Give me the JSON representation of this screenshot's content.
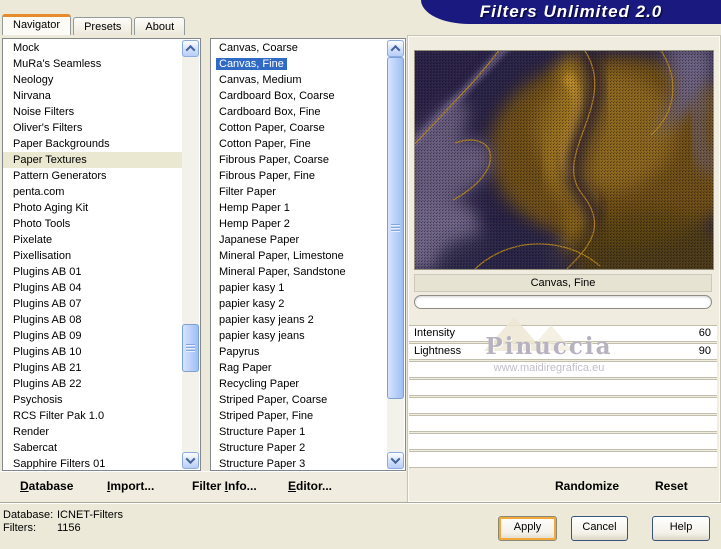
{
  "titlebar": {
    "title": "Filters Unlimited 2.0"
  },
  "tabs": {
    "navigator": "Navigator",
    "presets": "Presets",
    "about": "About"
  },
  "navigator": {
    "categories": [
      "Mock",
      "MuRa's Seamless",
      "Neology",
      "Nirvana",
      "Noise Filters",
      "Oliver's Filters",
      "Paper Backgrounds",
      "Paper Textures",
      "Pattern Generators",
      "penta.com",
      "Photo Aging Kit",
      "Photo Tools",
      "Pixelate",
      "Pixellisation",
      "Plugins AB 01",
      "Plugins AB 04",
      "Plugins AB 07",
      "Plugins AB 08",
      "Plugins AB 09",
      "Plugins AB 10",
      "Plugins AB 21",
      "Plugins AB 22",
      "Psychosis",
      "RCS Filter Pak 1.0",
      "Render",
      "Sabercat",
      "Sapphire Filters 01"
    ],
    "selected_category": "Paper Textures",
    "filters": [
      "Canvas, Coarse",
      "Canvas, Fine",
      "Canvas, Medium",
      "Cardboard Box, Coarse",
      "Cardboard Box, Fine",
      "Cotton Paper, Coarse",
      "Cotton Paper, Fine",
      "Fibrous Paper, Coarse",
      "Fibrous Paper, Fine",
      "Filter Paper",
      "Hemp Paper 1",
      "Hemp Paper 2",
      "Japanese Paper",
      "Mineral Paper, Limestone",
      "Mineral Paper, Sandstone",
      "papier kasy 1",
      "papier kasy 2",
      "papier kasy jeans 2",
      "papier kasy jeans",
      "Papyrus",
      "Rag Paper",
      "Recycling Paper",
      "Striped Paper, Coarse",
      "Striped Paper, Fine",
      "Structure Paper 1",
      "Structure Paper 2",
      "Structure Paper 3"
    ],
    "selected_filter": "Canvas, Fine"
  },
  "preview": {
    "caption": "Canvas, Fine",
    "watermark": {
      "name": "Pinuccia",
      "url": "www.maidiregrafica.eu"
    }
  },
  "controls": {
    "sliders": [
      {
        "label": "Intensity",
        "value": "60"
      },
      {
        "label": "Lightness",
        "value": "90"
      }
    ]
  },
  "toolbar": {
    "items": [
      {
        "pre": "",
        "accel": "D",
        "rest": "atabase"
      },
      {
        "pre": "",
        "accel": "I",
        "rest": "mport..."
      },
      {
        "pre": "Filter ",
        "accel": "I",
        "rest": "nfo..."
      },
      {
        "pre": "",
        "accel": "E",
        "rest": "ditor..."
      }
    ],
    "randomize": "Randomize",
    "reset": "Reset"
  },
  "status": {
    "database_label": "Database:",
    "database_value": "ICNET-Filters",
    "filters_label": "Filters:",
    "filters_value": "1156"
  },
  "buttons": {
    "apply": "Apply",
    "cancel": "Cancel",
    "help": "Help"
  },
  "colors": {
    "background_beige": "#ece9d8",
    "title_navy": "#191980",
    "selection_blue": "#316ac5",
    "tab_accent_orange": "#e68b2c",
    "category_highlight": "#ebe8d2"
  }
}
